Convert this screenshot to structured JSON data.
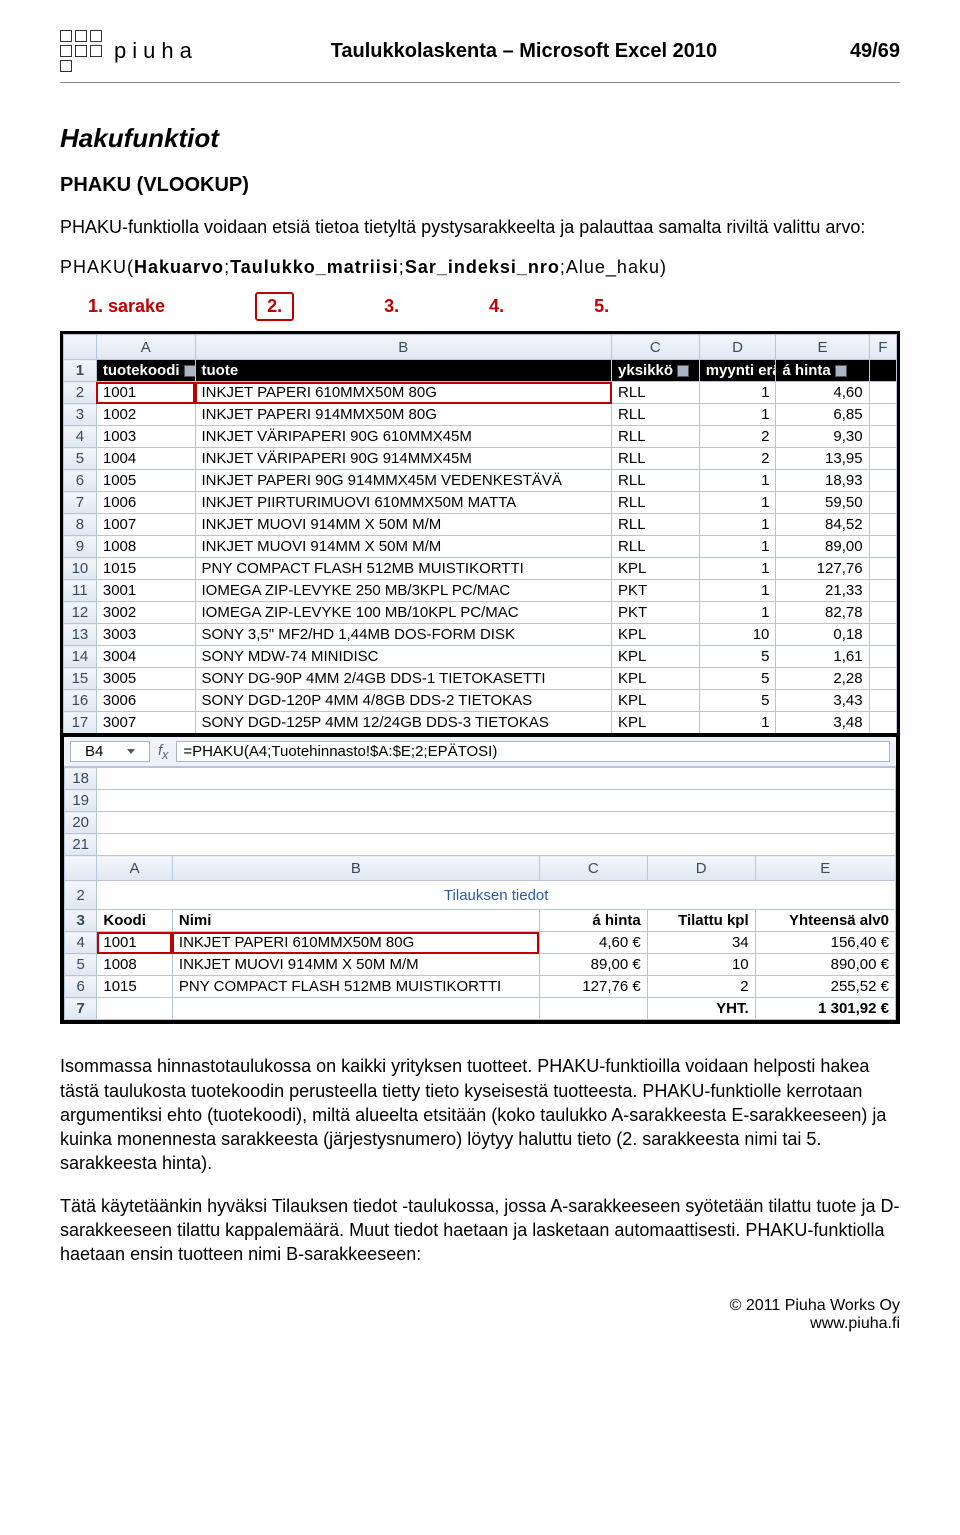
{
  "header": {
    "brand": "piuha",
    "title": "Taulukkolaskenta – Microsoft Excel 2010",
    "page": "49/69"
  },
  "section_title": "Hakufunktiot",
  "subsection_title": "PHAKU (VLOOKUP)",
  "intro": "PHAKU-funktiolla voidaan etsiä tietoa tietyltä pystysarakkeelta ja palauttaa samalta riviltä valittu arvo:",
  "formula": {
    "fn": "PHAKU(",
    "a1": "Hakuarvo",
    "a2": "Taulukko_matriisi",
    "a3": "Sar_indeksi_nro",
    "a4": "Alue_haku",
    "close": ")"
  },
  "arg_labels": [
    "1. sarake",
    "2.",
    "3.",
    "4.",
    "5."
  ],
  "price_table": {
    "cols": [
      "",
      "A",
      "B",
      "C",
      "D",
      "E",
      "F"
    ],
    "header_row": {
      "row": "1",
      "tuotekoodi": "tuotekoodi",
      "tuote": "tuote",
      "yksikko": "yksikkö",
      "myynti": "myynti erä",
      "hinta": "á hinta"
    },
    "rows": [
      {
        "r": "2",
        "code": "1001",
        "name": "INKJET PAPERI 610MMX50M 80G",
        "unit": "RLL",
        "qty": "1",
        "price": "4,60"
      },
      {
        "r": "3",
        "code": "1002",
        "name": "INKJET PAPERI 914MMX50M 80G",
        "unit": "RLL",
        "qty": "1",
        "price": "6,85"
      },
      {
        "r": "4",
        "code": "1003",
        "name": "INKJET VÄRIPAPERI 90G 610MMX45M",
        "unit": "RLL",
        "qty": "2",
        "price": "9,30"
      },
      {
        "r": "5",
        "code": "1004",
        "name": "INKJET VÄRIPAPERI 90G 914MMX45M",
        "unit": "RLL",
        "qty": "2",
        "price": "13,95"
      },
      {
        "r": "6",
        "code": "1005",
        "name": "INKJET PAPERI 90G 914MMX45M VEDENKESTÄVÄ",
        "unit": "RLL",
        "qty": "1",
        "price": "18,93"
      },
      {
        "r": "7",
        "code": "1006",
        "name": "INKJET PIIRTURIMUOVI 610MMX50M MATTA",
        "unit": "RLL",
        "qty": "1",
        "price": "59,50"
      },
      {
        "r": "8",
        "code": "1007",
        "name": "INKJET MUOVI 914MM X 50M M/M",
        "unit": "RLL",
        "qty": "1",
        "price": "84,52"
      },
      {
        "r": "9",
        "code": "1008",
        "name": "INKJET MUOVI 914MM X 50M M/M",
        "unit": "RLL",
        "qty": "1",
        "price": "89,00"
      },
      {
        "r": "10",
        "code": "1015",
        "name": "PNY COMPACT FLASH 512MB MUISTIKORTTI",
        "unit": "KPL",
        "qty": "1",
        "price": "127,76"
      },
      {
        "r": "11",
        "code": "3001",
        "name": "IOMEGA ZIP-LEVYKE 250 MB/3KPL PC/MAC",
        "unit": "PKT",
        "qty": "1",
        "price": "21,33"
      },
      {
        "r": "12",
        "code": "3002",
        "name": "IOMEGA ZIP-LEVYKE 100 MB/10KPL PC/MAC",
        "unit": "PKT",
        "qty": "1",
        "price": "82,78"
      },
      {
        "r": "13",
        "code": "3003",
        "name": "SONY 3,5\" MF2/HD 1,44MB DOS-FORM DISK",
        "unit": "KPL",
        "qty": "10",
        "price": "0,18"
      },
      {
        "r": "14",
        "code": "3004",
        "name": "SONY MDW-74 MINIDISC",
        "unit": "KPL",
        "qty": "5",
        "price": "1,61"
      },
      {
        "r": "15",
        "code": "3005",
        "name": "SONY DG-90P 4MM 2/4GB DDS-1 TIETOKASETTI",
        "unit": "KPL",
        "qty": "5",
        "price": "2,28"
      },
      {
        "r": "16",
        "code": "3006",
        "name": "SONY DGD-120P 4MM 4/8GB DDS-2 TIETOKAS",
        "unit": "KPL",
        "qty": "5",
        "price": "3,43"
      },
      {
        "r": "17",
        "code": "3007",
        "name": "SONY DGD-125P 4MM 12/24GB DDS-3 TIETOKAS",
        "unit": "KPL",
        "qty": "1",
        "price": "3,48"
      }
    ]
  },
  "order_table": {
    "cellref": "B4",
    "formula_text": "=PHAKU(A4;Tuotehinnasto!$A:$E;2;EPÄTOSI)",
    "cols": [
      "",
      "A",
      "B",
      "C",
      "D",
      "E"
    ],
    "title": "Tilauksen tiedot",
    "header_row": {
      "r": "3",
      "koodi": "Koodi",
      "nimi": "Nimi",
      "ahinta": "á hinta",
      "tilattu": "Tilattu kpl",
      "yhteensa": "Yhteensä alv0"
    },
    "rows": [
      {
        "r": "4",
        "koodi": "1001",
        "nimi": "INKJET PAPERI 610MMX50M 80G",
        "ahinta": "4,60 €",
        "tilattu": "34",
        "yhteensa": "156,40 €"
      },
      {
        "r": "5",
        "koodi": "1008",
        "nimi": "INKJET MUOVI 914MM X 50M M/M",
        "ahinta": "89,00 €",
        "tilattu": "10",
        "yhteensa": "890,00 €"
      },
      {
        "r": "6",
        "koodi": "1015",
        "nimi": "PNY COMPACT FLASH 512MB MUISTIKORTTI",
        "ahinta": "127,76 €",
        "tilattu": "2",
        "yhteensa": "255,52 €"
      }
    ],
    "footer": {
      "r": "7",
      "label": "YHT.",
      "total": "1 301,92 €"
    },
    "extra_rows": [
      "18",
      "19",
      "20",
      "21"
    ]
  },
  "para1": "Isommassa hinnastotaulukossa on kaikki yrityksen tuotteet. PHAKU-funktioilla voidaan helposti hakea tästä taulukosta tuotekoodin perusteella tietty tieto kyseisestä tuotteesta. PHAKU-funktiolle kerrotaan argumentiksi ehto (tuotekoodi), miltä alueelta etsitään (koko taulukko A-sarakkeesta E-sarakkeeseen) ja kuinka monennesta sarakkeesta (järjestysnumero) löytyy haluttu tieto (2. sarakkeesta nimi tai 5. sarakkeesta hinta).",
  "para2": "Tätä käytetäänkin hyväksi Tilauksen tiedot -taulukossa, jossa A-sarakkeeseen syötetään tilattu tuote ja D-sarakkeeseen tilattu kappalemäärä. Muut tiedot haetaan ja lasketaan automaattisesti. PHAKU-funktiolla haetaan ensin tuotteen nimi B-sarakkeeseen:",
  "footer": {
    "company": "© 2011 Piuha Works Oy",
    "url": "www.piuha.fi"
  }
}
